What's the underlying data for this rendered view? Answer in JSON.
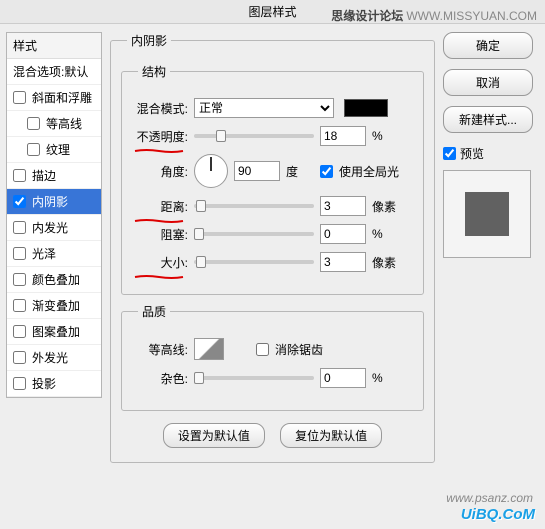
{
  "title": "图层样式",
  "watermark_top": "思缘设计论坛",
  "watermark_top2": "WWW.MISSYUAN.COM",
  "left": {
    "header": "样式",
    "blend_head": "混合选项:默认",
    "items": [
      {
        "label": "斜面和浮雕",
        "checked": false
      },
      {
        "label": "等高线",
        "checked": false,
        "sub": true
      },
      {
        "label": "纹理",
        "checked": false,
        "sub": true
      },
      {
        "label": "描边",
        "checked": false
      },
      {
        "label": "内阴影",
        "checked": true,
        "selected": true
      },
      {
        "label": "内发光",
        "checked": false
      },
      {
        "label": "光泽",
        "checked": false
      },
      {
        "label": "颜色叠加",
        "checked": false
      },
      {
        "label": "渐变叠加",
        "checked": false
      },
      {
        "label": "图案叠加",
        "checked": false
      },
      {
        "label": "外发光",
        "checked": false
      },
      {
        "label": "投影",
        "checked": false
      }
    ]
  },
  "panel": {
    "title": "内阴影",
    "structure": "结构",
    "blend_mode_lbl": "混合模式:",
    "blend_mode_val": "正常",
    "opacity_lbl": "不透明度:",
    "opacity_val": "18",
    "angle_lbl": "角度:",
    "angle_val": "90",
    "angle_unit": "度",
    "global_light": "使用全局光",
    "distance_lbl": "距离:",
    "distance_val": "3",
    "px": "像素",
    "choke_lbl": "阻塞:",
    "choke_val": "0",
    "pct": "%",
    "size_lbl": "大小:",
    "size_val": "3",
    "quality": "品质",
    "contour_lbl": "等高线:",
    "antialias": "消除锯齿",
    "noise_lbl": "杂色:",
    "noise_val": "0",
    "defaults": "设置为默认值",
    "reset": "复位为默认值"
  },
  "right": {
    "ok": "确定",
    "cancel": "取消",
    "new_style": "新建样式...",
    "preview": "预览"
  },
  "footer": {
    "wm1": "www.psanz.com",
    "wm2": "UiBQ.CoM"
  }
}
